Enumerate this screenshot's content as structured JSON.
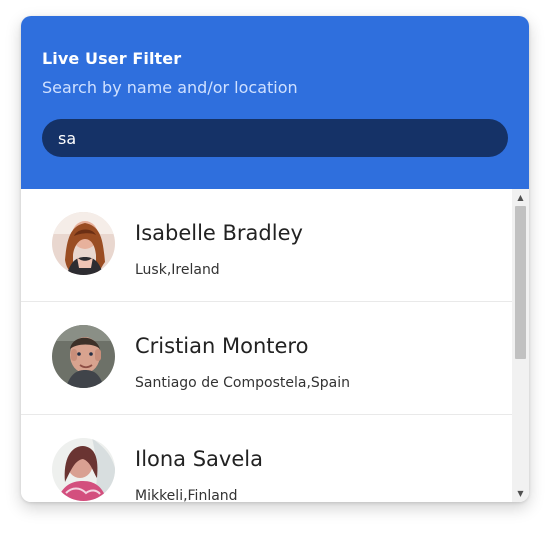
{
  "header": {
    "title": "Live User Filter",
    "subtitle": "Search by name and/or location"
  },
  "search": {
    "value": "sa",
    "placeholder": ""
  },
  "users": [
    {
      "name": "Isabelle Bradley",
      "location": "Lusk,Ireland"
    },
    {
      "name": "Cristian Montero",
      "location": "Santiago de Compostela,Spain"
    },
    {
      "name": "Ilona Savela",
      "location": "Mikkeli,Finland"
    }
  ],
  "colors": {
    "header_bg": "#2f6fdd",
    "search_bg": "#153267",
    "text_primary": "#222222",
    "text_secondary": "#333333"
  },
  "icons": {
    "scroll_up": "▲",
    "scroll_down": "▼"
  }
}
